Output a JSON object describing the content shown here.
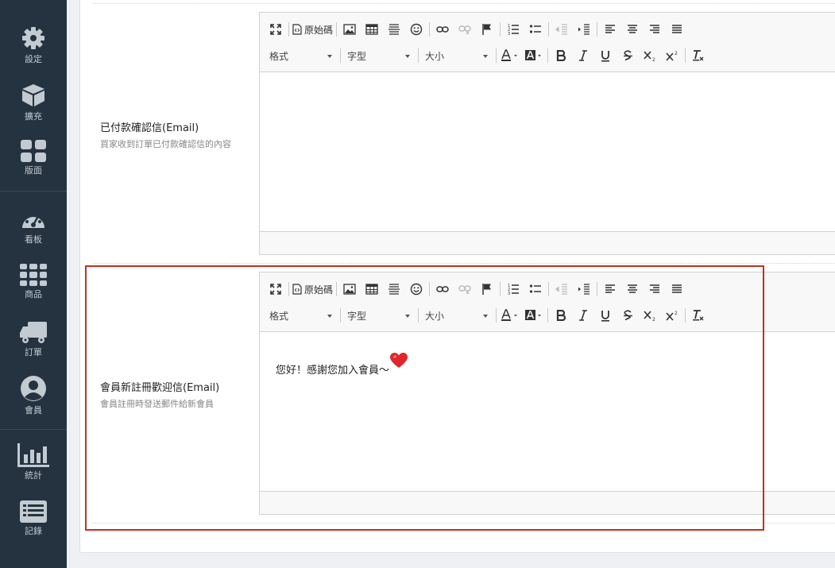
{
  "sidebar": {
    "items": [
      {
        "label": "設定",
        "icon": "gear-icon"
      },
      {
        "label": "擴充",
        "icon": "cube-icon"
      },
      {
        "label": "版面",
        "icon": "layout-grid-icon"
      },
      {
        "label": "看板",
        "icon": "dashboard-gauge-icon"
      },
      {
        "label": "商品",
        "icon": "grid-nine-icon"
      },
      {
        "label": "訂單",
        "icon": "truck-icon"
      },
      {
        "label": "會員",
        "icon": "user-circle-icon"
      },
      {
        "label": "統計",
        "icon": "bar-chart-icon"
      },
      {
        "label": "記錄",
        "icon": "list-icon"
      }
    ]
  },
  "toolbar": {
    "source_label": "原始碼",
    "format_label": "格式",
    "font_label": "字型",
    "size_label": "大小"
  },
  "rows": {
    "paid": {
      "title": "已付款確認信(Email)",
      "desc": "買家收到訂單已付款確認信的內容",
      "content": ""
    },
    "welcome": {
      "title": "會員新註冊歡迎信(Email)",
      "desc": "會員註冊時發送郵件給新會員",
      "content": "您好！感謝您加入會員～"
    }
  },
  "colors": {
    "sidebar_bg": "#253340",
    "highlight": "#c0311e",
    "heart": "#e0262a"
  }
}
